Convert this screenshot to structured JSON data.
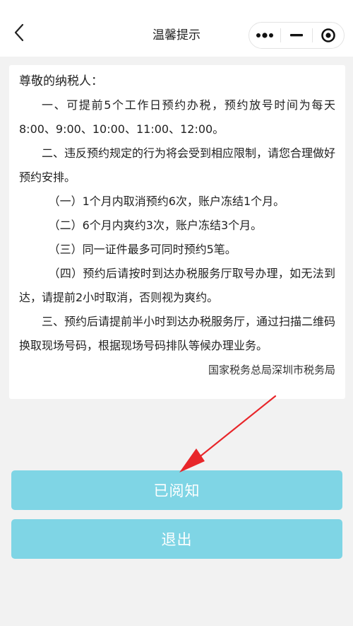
{
  "nav": {
    "title": "温馨提示",
    "back_icon": "chevron-left-icon",
    "more_icon": "more-dots-icon",
    "minimize_icon": "minus-icon",
    "close_icon": "target-icon"
  },
  "notice": {
    "greeting": "尊敬的纳税人：",
    "p1": "一、可提前5个工作日预约办税，预约放号时间为每天8:00、9:00、10:00、11:00、12:00。",
    "p2": "二、违反预约规定的行为将会受到相应限制，请您合理做好预约安排。",
    "p2_1": "（一）1个月内取消预约6次，账户冻结1个月。",
    "p2_2": "（二）6个月内爽约3次，账户冻结3个月。",
    "p2_3": "（三）同一证件最多可同时预约5笔。",
    "p2_4": "（四）预约后请按时到达办税服务厅取号办理，如无法到达，请提前2小时取消，否则视为爽约。",
    "p3": "三、预约后请提前半小时到达办税服务厅，通过扫描二维码换取现场号码，根据现场号码排队等候办理业务。",
    "signature": "国家税务总局深圳市税务局"
  },
  "buttons": {
    "ack_label": "已阅知",
    "exit_label": "退出"
  },
  "colors": {
    "button_bg": "#7fd5e5",
    "annotation_arrow": "#e8262a"
  }
}
